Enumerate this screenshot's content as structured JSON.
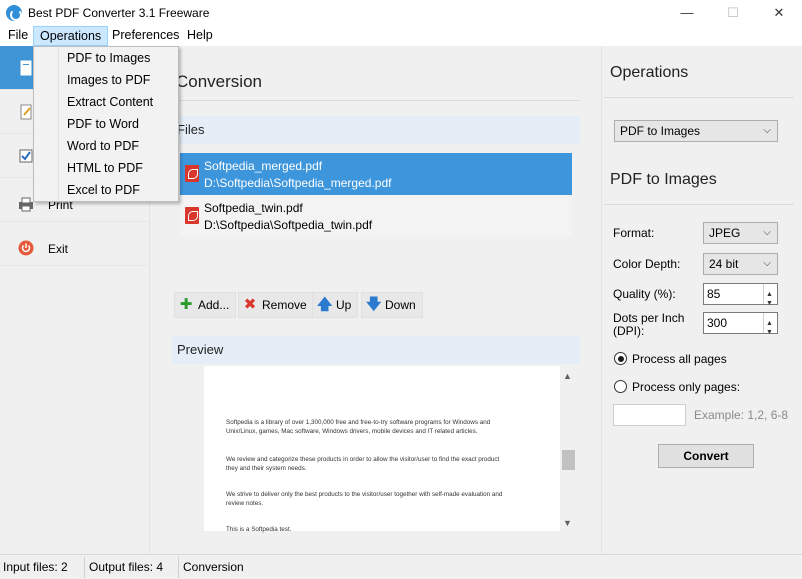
{
  "window": {
    "title": "Best PDF Converter 3.1 Freeware",
    "controls": {
      "minimize": "—",
      "maximize": "☐",
      "close": "✕"
    }
  },
  "menu": {
    "file": "File",
    "operations": "Operations",
    "preferences": "Preferences",
    "help": "Help"
  },
  "dropdown": {
    "items": [
      "PDF to Images",
      "Images to PDF",
      "Extract Content",
      "PDF to Word",
      "Word to PDF",
      "HTML to PDF",
      "Excel to PDF"
    ]
  },
  "sidebar": {
    "items": [
      {
        "label": "",
        "icon": "convert-icon"
      },
      {
        "label": "",
        "icon": "edit-icon"
      },
      {
        "label": "",
        "icon": "check-icon"
      },
      {
        "label": "Print",
        "icon": "printer-icon"
      },
      {
        "label": "Exit",
        "icon": "power-icon"
      }
    ]
  },
  "main": {
    "title": "Conversion",
    "files_header": "Files",
    "files": [
      {
        "name": "Softpedia_merged.pdf",
        "path": "D:\\Softpedia\\Softpedia_merged.pdf",
        "selected": true
      },
      {
        "name": "Softpedia_twin.pdf",
        "path": "D:\\Softpedia\\Softpedia_twin.pdf",
        "selected": false
      }
    ],
    "toolbar": {
      "add": "Add...",
      "remove": "Remove",
      "up": "Up",
      "down": "Down"
    },
    "preview_header": "Preview",
    "preview_lines": [
      "Softpedia is a library of over 1,300,000 free and free-to-try software programs for Windows and",
      "Unix/Linux, games, Mac software, Windows drivers, mobile devices and IT related articles.",
      "We review and categorize these products in order to allow the visitor/user to find the exact product",
      "they and their system needs.",
      "We strive to deliver only the best products to the visitor/user together with self-made evaluation and",
      "review notes.",
      "This is a Softpedia test."
    ]
  },
  "operations_panel": {
    "title": "Operations",
    "selected_operation": "PDF to Images",
    "section_title": "PDF to Images",
    "format_label": "Format:",
    "format_value": "JPEG",
    "color_depth_label": "Color Depth:",
    "color_depth_value": "24 bit",
    "quality_label": "Quality (%):",
    "quality_value": "85",
    "dpi_label_1": "Dots per Inch",
    "dpi_label_2": "(DPI):",
    "dpi_value": "300",
    "radio_all": "Process all pages",
    "radio_only": "Process only pages:",
    "pages_value": "",
    "pages_example": "Example: 1,2, 6-8",
    "convert_button": "Convert"
  },
  "status": {
    "input_files": "Input files: 2",
    "output_files": "Output files: 4",
    "mode": "Conversion"
  }
}
